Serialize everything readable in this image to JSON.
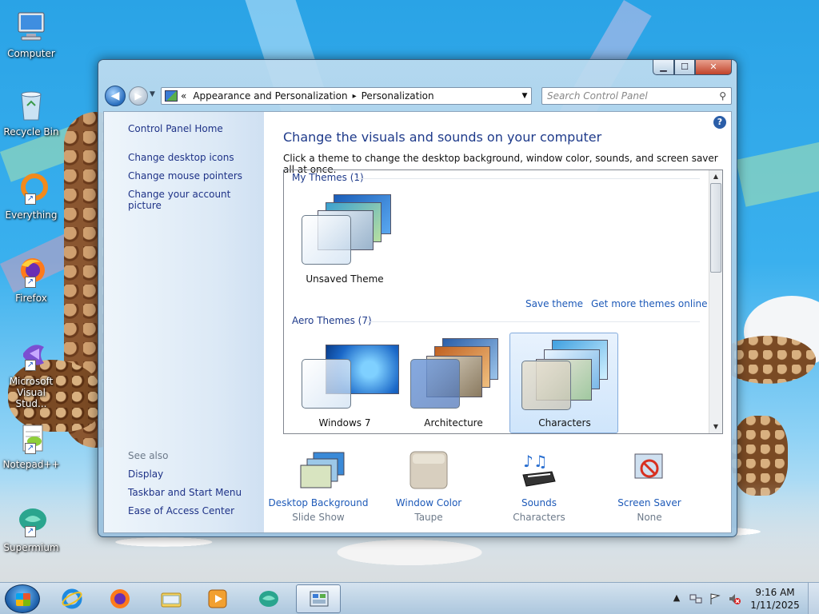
{
  "desktop_icons": [
    {
      "label": "Computer",
      "icon": "computer-icon"
    },
    {
      "label": "Recycle Bin",
      "icon": "recycle-bin-icon"
    },
    {
      "label": "Everything",
      "icon": "everything-icon"
    },
    {
      "label": "Firefox",
      "icon": "firefox-icon"
    },
    {
      "label": "Microsoft Visual Stud...",
      "icon": "visual-studio-icon"
    },
    {
      "label": "Notepad++",
      "icon": "notepadpp-icon"
    },
    {
      "label": "Supermium",
      "icon": "supermium-icon"
    }
  ],
  "window": {
    "address": {
      "prefix": "«",
      "crumb1": "Appearance and Personalization",
      "crumb2": "Personalization"
    },
    "search_placeholder": "Search Control Panel",
    "left_pane": {
      "home": "Control Panel Home",
      "links": [
        "Change desktop icons",
        "Change mouse pointers",
        "Change your account picture"
      ],
      "see_also": "See also",
      "see_also_links": [
        "Display",
        "Taskbar and Start Menu",
        "Ease of Access Center"
      ]
    },
    "title": "Change the visuals and sounds on your computer",
    "subtitle": "Click a theme to change the desktop background, window color, sounds, and screen saver all at once.",
    "my_themes": {
      "label": "My Themes (1)",
      "items": [
        {
          "name": "Unsaved Theme"
        }
      ]
    },
    "save_theme": "Save theme",
    "get_more": "Get more themes online",
    "aero_themes": {
      "label": "Aero Themes (7)",
      "items": [
        {
          "name": "Windows 7"
        },
        {
          "name": "Architecture"
        },
        {
          "name": "Characters",
          "selected": true
        }
      ]
    },
    "bottom": [
      {
        "link": "Desktop Background",
        "value": "Slide Show",
        "icon": "desktop-background-icon"
      },
      {
        "link": "Window Color",
        "value": "Taupe",
        "icon": "window-color-icon"
      },
      {
        "link": "Sounds",
        "value": "Characters",
        "icon": "sounds-icon"
      },
      {
        "link": "Screen Saver",
        "value": "None",
        "icon": "screen-saver-icon"
      }
    ],
    "colors": {
      "window_color_swatch": "#d8cfbf",
      "link": "#1e5ab8",
      "title": "#1e3a8a"
    }
  },
  "taskbar": {
    "pinned": [
      "internet-explorer-icon",
      "firefox-icon",
      "file-explorer-icon",
      "media-player-icon",
      "supermium-icon",
      "control-panel-icon"
    ],
    "active": "control-panel-icon",
    "time": "9:16 AM",
    "date": "1/11/2025"
  }
}
